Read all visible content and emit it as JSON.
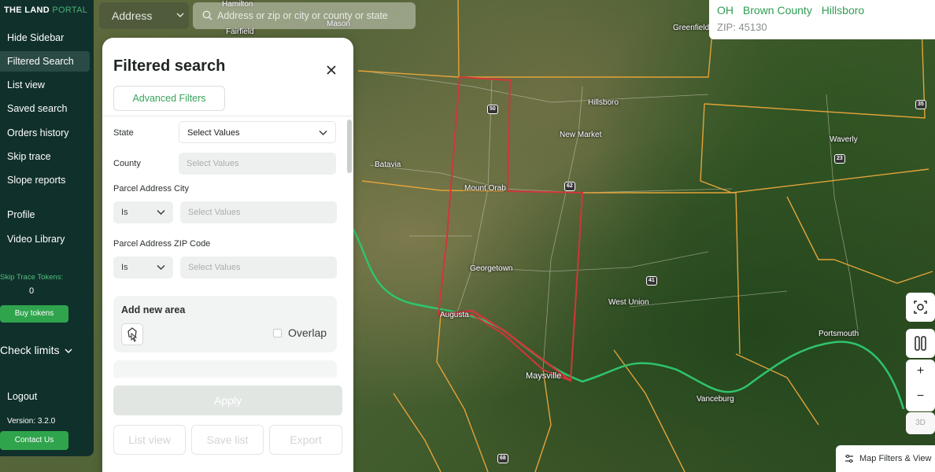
{
  "sidebar": {
    "logo_main": "THE LAND",
    "logo_accent": "PORTAL",
    "items": [
      {
        "label": "Hide Sidebar"
      },
      {
        "label": "Filtered Search"
      },
      {
        "label": "List view"
      },
      {
        "label": "Saved search"
      },
      {
        "label": "Orders history"
      },
      {
        "label": "Skip trace"
      },
      {
        "label": "Slope reports"
      },
      {
        "label": "Profile"
      },
      {
        "label": "Video Library"
      }
    ],
    "tokens_label": "Skip Trace Tokens:",
    "tokens_count": "0",
    "buy_tokens": "Buy tokens",
    "check_limits": "Check limits",
    "logout": "Logout",
    "version": "Version: 3.2.0",
    "contact": "Contact Us"
  },
  "search": {
    "mode": "Address",
    "placeholder": "Address or zip or city or county or state"
  },
  "location": {
    "state": "OH",
    "county": "Brown County",
    "city": "Hillsboro",
    "zip": "ZIP: 45130"
  },
  "panel": {
    "title": "Filtered search",
    "advanced_filters": "Advanced Filters",
    "state_label": "State",
    "state_value": "Select Values",
    "county_label": "County",
    "county_value": "Select Values",
    "city_label": "Parcel Address City",
    "city_op": "Is",
    "city_value": "Select Values",
    "zip_label": "Parcel Address ZIP Code",
    "zip_op": "Is",
    "zip_value": "Select Values",
    "add_area": "Add new area",
    "overlap": "Overlap",
    "apply": "Apply",
    "list_view": "List view",
    "save_list": "Save list",
    "export": "Export"
  },
  "map": {
    "labels": [
      "Hamilton",
      "Fairfield",
      "Mason",
      "Greenfield",
      "Hillsboro",
      "New Market",
      "Batavia",
      "Mount Orab",
      "Georgetown",
      "West Union",
      "Augusta",
      "Maysville",
      "Vanceburg",
      "Portsmouth",
      "Waverly"
    ],
    "shields": [
      "50",
      "62",
      "41",
      "23",
      "35",
      "68"
    ],
    "zoom_in": "+",
    "zoom_out": "−",
    "three_d": "3D",
    "filters_view": "Map Filters & View",
    "colors": {
      "boundary": "#d1363a",
      "county_lines": "#e3a33a",
      "river": "#2fc46d"
    }
  }
}
